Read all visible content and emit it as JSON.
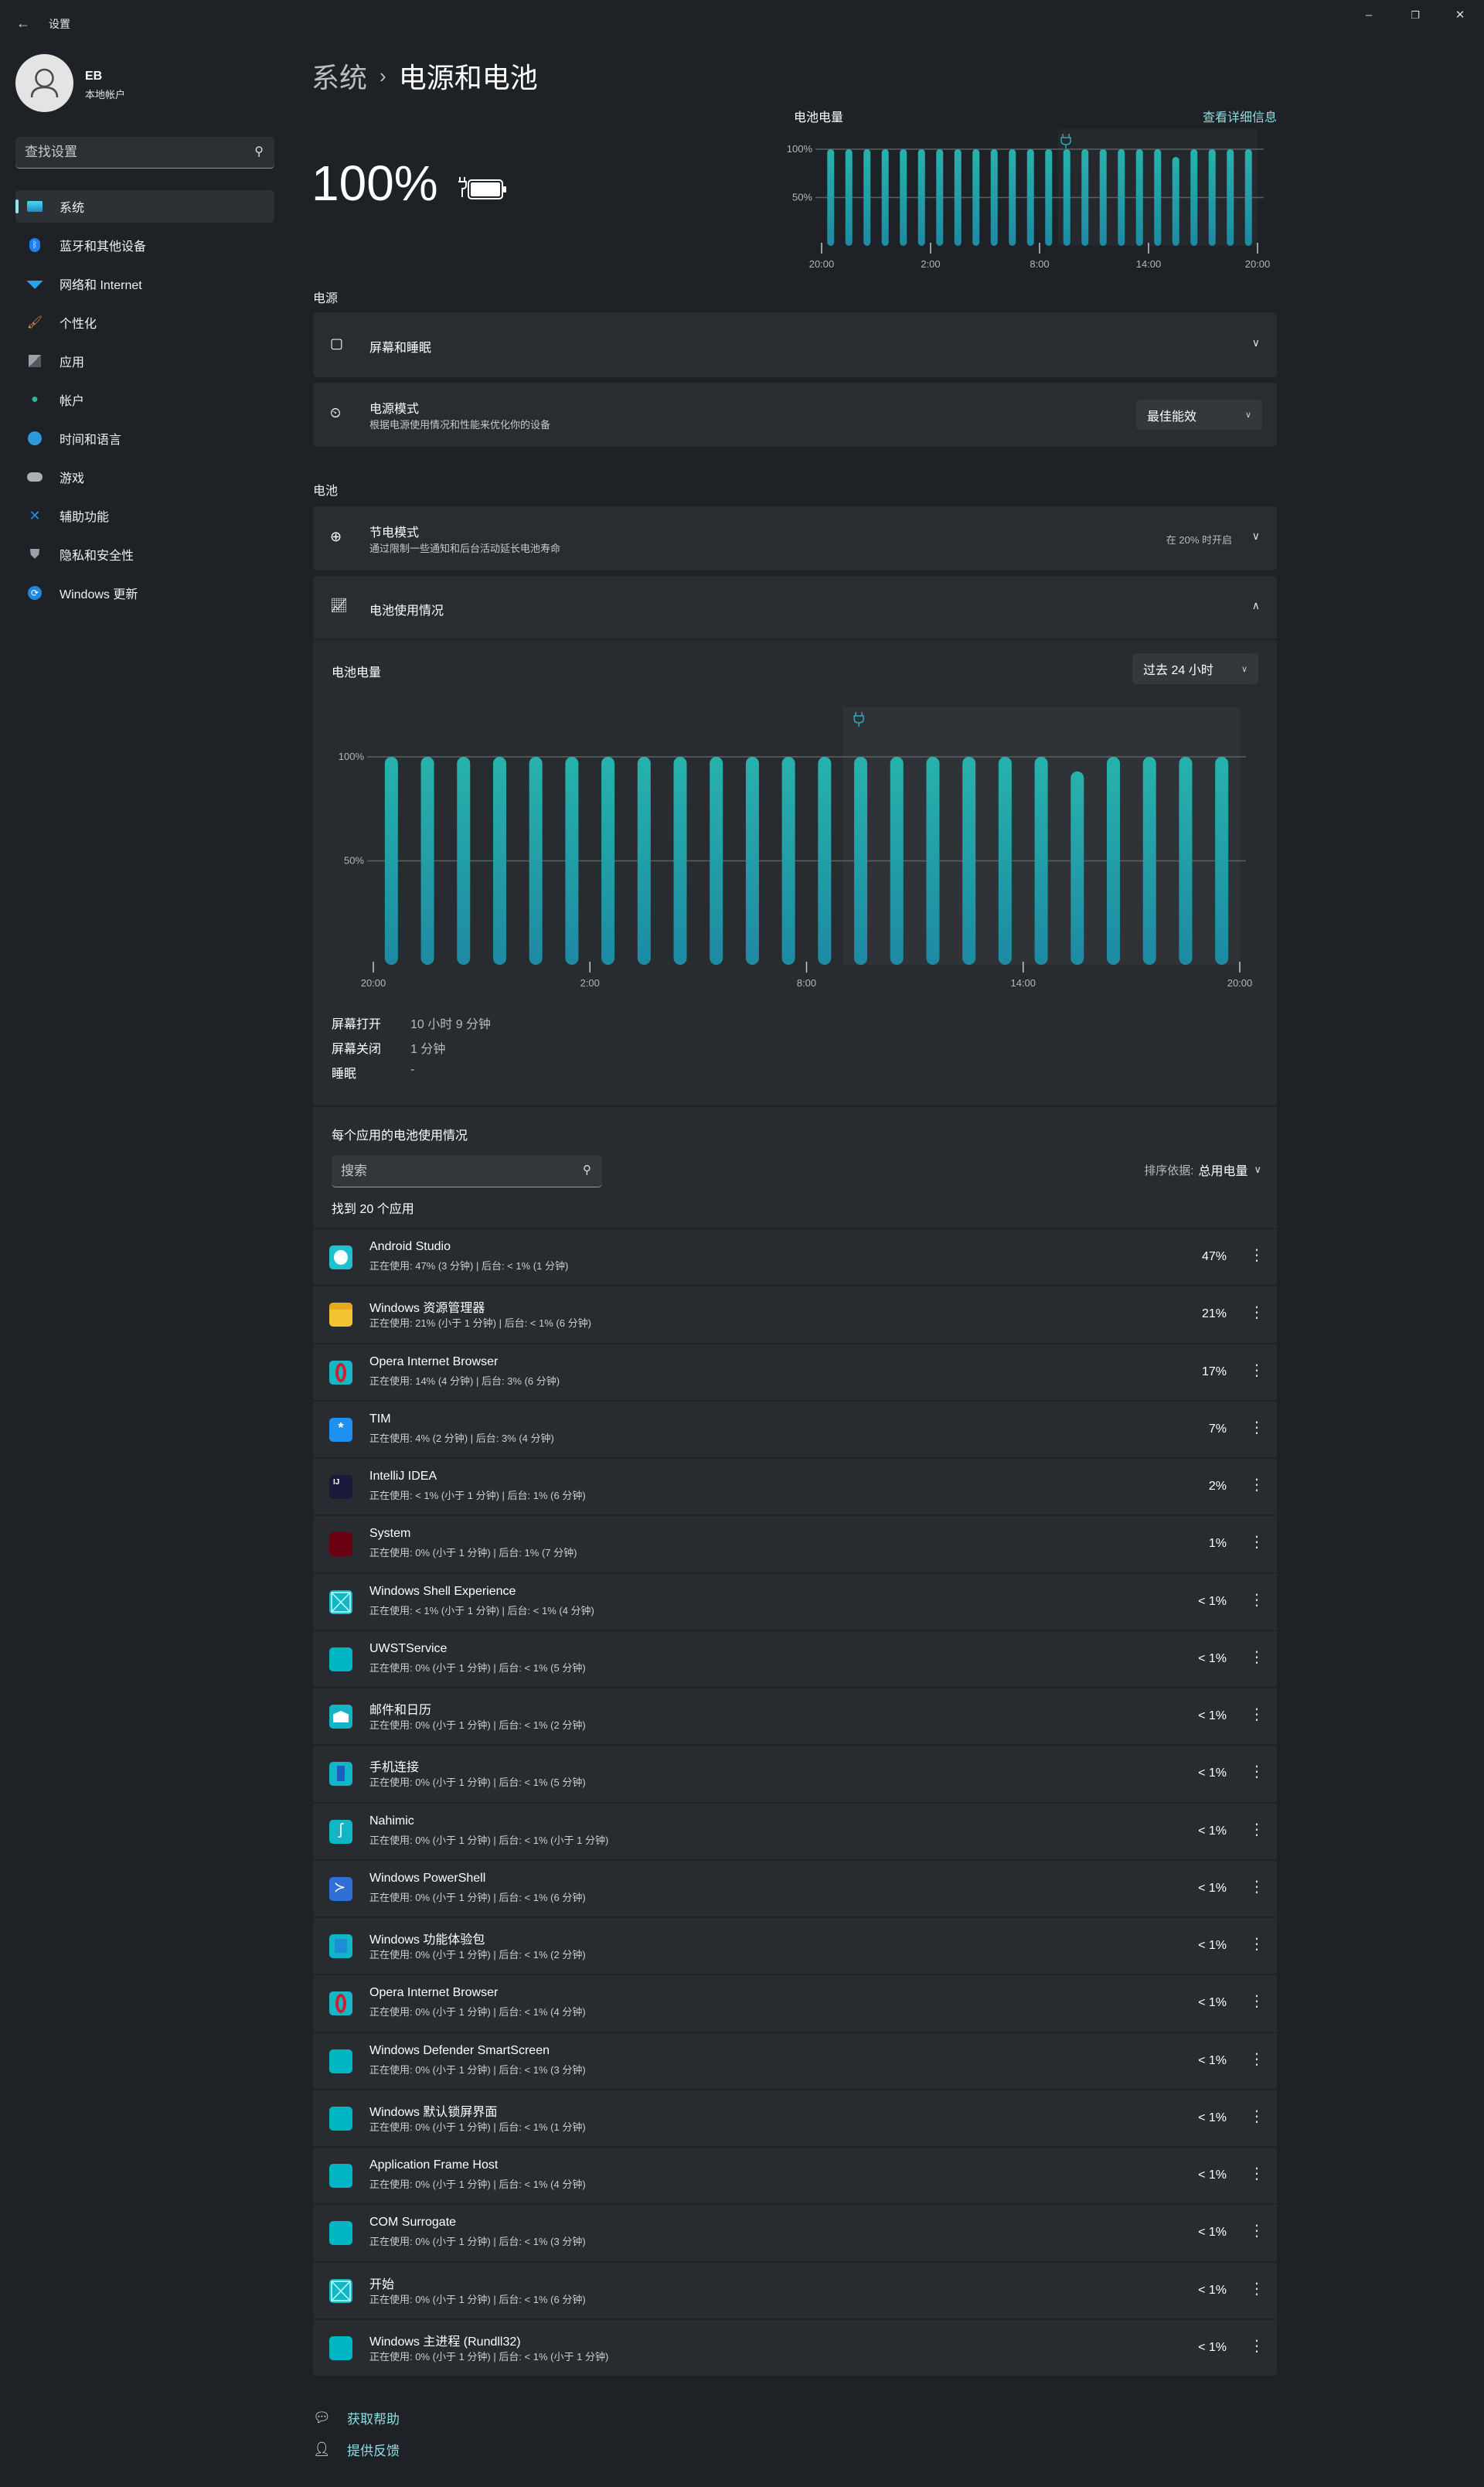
{
  "window": {
    "title": "设置",
    "controls": {
      "minimize": "–",
      "restore": "❐",
      "close": "✕"
    }
  },
  "user": {
    "name": "EB",
    "type": "本地帐户"
  },
  "sidebar": {
    "search_placeholder": "查找设置",
    "items": [
      {
        "label": "系统",
        "icon": "system-icon",
        "active": true
      },
      {
        "label": "蓝牙和其他设备",
        "icon": "bluetooth-icon"
      },
      {
        "label": "网络和 Internet",
        "icon": "wifi-icon"
      },
      {
        "label": "个性化",
        "icon": "brush-icon"
      },
      {
        "label": "应用",
        "icon": "apps-icon"
      },
      {
        "label": "帐户",
        "icon": "account-icon"
      },
      {
        "label": "时间和语言",
        "icon": "globe-clock-icon"
      },
      {
        "label": "游戏",
        "icon": "gamepad-icon"
      },
      {
        "label": "辅助功能",
        "icon": "accessibility-icon"
      },
      {
        "label": "隐私和安全性",
        "icon": "shield-icon"
      },
      {
        "label": "Windows 更新",
        "icon": "update-icon"
      }
    ]
  },
  "breadcrumb": {
    "parent": "系统",
    "separator": "›",
    "current": "电源和电池"
  },
  "battery": {
    "percent": "100%",
    "state_icon": "battery-charging-icon"
  },
  "mini_chart": {
    "title": "电池电量",
    "link": "查看详细信息"
  },
  "power_section": {
    "label": "电源",
    "screen_sleep": {
      "title": "屏幕和睡眠"
    },
    "power_mode": {
      "title": "电源模式",
      "subtitle": "根据电源使用情况和性能来优化你的设备",
      "value": "最佳能效"
    }
  },
  "battery_section": {
    "label": "电池",
    "saver": {
      "title": "节电模式",
      "subtitle": "通过限制一些通知和后台活动延长电池寿命",
      "status": "在 20% 时开启"
    },
    "usage": {
      "title": "电池使用情况",
      "chart_title": "电池电量",
      "range": "过去 24 小时",
      "stats": [
        {
          "label": "屏幕打开",
          "value": "10 小时 9 分钟"
        },
        {
          "label": "屏幕关闭",
          "value": "1 分钟"
        },
        {
          "label": "睡眠",
          "value": "-"
        }
      ],
      "per_app_title": "每个应用的电池使用情况",
      "search_placeholder": "搜索",
      "sort_label": "排序依据:",
      "sort_value": "总用电量",
      "found": "找到 20 个应用"
    }
  },
  "apps": [
    {
      "name": "Android Studio",
      "detail": "正在使用: 47% (3 分钟) | 后台: < 1% (1 分钟)",
      "pct": "47%",
      "icon": "android-studio-icon",
      "color": "#1fc1cf"
    },
    {
      "name": "Windows 资源管理器",
      "detail": "正在使用: 21% (小于 1 分钟) | 后台: < 1% (6 分钟)",
      "pct": "21%",
      "icon": "file-explorer-icon",
      "color": "#f3c434"
    },
    {
      "name": "Opera Internet Browser",
      "detail": "正在使用: 14% (4 分钟) | 后台: 3% (6 分钟)",
      "pct": "17%",
      "icon": "opera-icon",
      "color": "#13b7c6"
    },
    {
      "name": "TIM",
      "detail": "正在使用: 4% (2 分钟) | 后台: 3% (4 分钟)",
      "pct": "7%",
      "icon": "tim-icon",
      "color": "#1e90f0"
    },
    {
      "name": "IntelliJ IDEA",
      "detail": "正在使用: < 1% (小于 1 分钟) | 后台: 1% (6 分钟)",
      "pct": "2%",
      "icon": "intellij-icon",
      "color": "#1a1a3a"
    },
    {
      "name": "System",
      "detail": "正在使用: 0% (小于 1 分钟) | 后台: 1% (7 分钟)",
      "pct": "1%",
      "icon": "system-app-icon",
      "color": "#6b0010"
    },
    {
      "name": "Windows Shell Experience",
      "detail": "正在使用: < 1% (小于 1 分钟) | 后台: < 1% (4 分钟)",
      "pct": "< 1%",
      "icon": "placeholder-x-icon",
      "color": "#15b6c4"
    },
    {
      "name": "UWSTService",
      "detail": "正在使用: 0% (小于 1 分钟) | 后台: < 1% (5 分钟)",
      "pct": "< 1%",
      "icon": "generic-app-icon",
      "color": "#00b6c4"
    },
    {
      "name": "邮件和日历",
      "detail": "正在使用: 0% (小于 1 分钟) | 后台: < 1% (2 分钟)",
      "pct": "< 1%",
      "icon": "mail-icon",
      "color": "#12b5c5"
    },
    {
      "name": "手机连接",
      "detail": "正在使用: 0% (小于 1 分钟) | 后台: < 1% (5 分钟)",
      "pct": "< 1%",
      "icon": "phone-link-icon",
      "color": "#12b5c5"
    },
    {
      "name": "Nahimic",
      "detail": "正在使用: 0% (小于 1 分钟) | 后台: < 1% (小于 1 分钟)",
      "pct": "< 1%",
      "icon": "nahimic-icon",
      "color": "#12b5c5"
    },
    {
      "name": "Windows PowerShell",
      "detail": "正在使用: 0% (小于 1 分钟) | 后台: < 1% (6 分钟)",
      "pct": "< 1%",
      "icon": "powershell-icon",
      "color": "#2f6fd6"
    },
    {
      "name": "Windows 功能体验包",
      "detail": "正在使用: 0% (小于 1 分钟) | 后台: < 1% (2 分钟)",
      "pct": "< 1%",
      "icon": "feature-pack-icon",
      "color": "#12b5c5"
    },
    {
      "name": "Opera Internet Browser",
      "detail": "正在使用: 0% (小于 1 分钟) | 后台: < 1% (4 分钟)",
      "pct": "< 1%",
      "icon": "opera-icon",
      "color": "#13b7c6"
    },
    {
      "name": "Windows Defender SmartScreen",
      "detail": "正在使用: 0% (小于 1 分钟) | 后台: < 1% (3 分钟)",
      "pct": "< 1%",
      "icon": "generic-app-icon",
      "color": "#00b6c4"
    },
    {
      "name": "Windows 默认锁屏界面",
      "detail": "正在使用: 0% (小于 1 分钟) | 后台: < 1% (1 分钟)",
      "pct": "< 1%",
      "icon": "generic-app-icon",
      "color": "#00b6c4"
    },
    {
      "name": "Application Frame Host",
      "detail": "正在使用: 0% (小于 1 分钟) | 后台: < 1% (4 分钟)",
      "pct": "< 1%",
      "icon": "generic-app-icon",
      "color": "#00b6c4"
    },
    {
      "name": "COM Surrogate",
      "detail": "正在使用: 0% (小于 1 分钟) | 后台: < 1% (3 分钟)",
      "pct": "< 1%",
      "icon": "generic-app-icon",
      "color": "#00b6c4"
    },
    {
      "name": "开始",
      "detail": "正在使用: 0% (小于 1 分钟) | 后台: < 1% (6 分钟)",
      "pct": "< 1%",
      "icon": "placeholder-x-icon",
      "color": "#15b6c4"
    },
    {
      "name": "Windows 主进程 (Rundll32)",
      "detail": "正在使用: 0% (小于 1 分钟) | 后台: < 1% (小于 1 分钟)",
      "pct": "< 1%",
      "icon": "generic-app-icon",
      "color": "#00b6c4"
    }
  ],
  "footer": {
    "help": "获取帮助",
    "feedback": "提供反馈"
  },
  "colors": {
    "accent": "#8fdde6",
    "bar_top": "#27b2ac",
    "bar_bottom": "#1e8aa3"
  },
  "chart_data": [
    {
      "type": "bar",
      "title": "电池电量",
      "categories": [
        "20:00",
        "21:00",
        "22:00",
        "23:00",
        "0:00",
        "1:00",
        "2:00",
        "3:00",
        "4:00",
        "5:00",
        "6:00",
        "7:00",
        "8:00",
        "9:00",
        "10:00",
        "11:00",
        "12:00",
        "13:00",
        "14:00",
        "15:00",
        "16:00",
        "17:00",
        "18:00",
        "19:00"
      ],
      "values": [
        100,
        100,
        100,
        100,
        100,
        100,
        100,
        100,
        100,
        100,
        100,
        100,
        100,
        100,
        100,
        100,
        100,
        100,
        100,
        92,
        100,
        100,
        100,
        100
      ],
      "xticks": [
        "20:00",
        "2:00",
        "8:00",
        "14:00",
        "20:00"
      ],
      "yticks": [
        "100%",
        "50%"
      ],
      "ylim": [
        0,
        100
      ],
      "charging_from_index": 13,
      "annotation": "plug-icon",
      "grid": true
    },
    {
      "type": "bar",
      "title": "电池电量",
      "categories": [
        "20:00",
        "21:00",
        "22:00",
        "23:00",
        "0:00",
        "1:00",
        "2:00",
        "3:00",
        "4:00",
        "5:00",
        "6:00",
        "7:00",
        "8:00",
        "9:00",
        "10:00",
        "11:00",
        "12:00",
        "13:00",
        "14:00",
        "15:00",
        "16:00",
        "17:00",
        "18:00",
        "19:00"
      ],
      "values": [
        100,
        100,
        100,
        100,
        100,
        100,
        100,
        100,
        100,
        100,
        100,
        100,
        100,
        100,
        100,
        100,
        100,
        100,
        100,
        93,
        100,
        100,
        100,
        100
      ],
      "xticks": [
        "20:00",
        "2:00",
        "8:00",
        "14:00",
        "20:00"
      ],
      "yticks": [
        "100%",
        "50%"
      ],
      "ylim": [
        0,
        100
      ],
      "charging_from_index": 13,
      "annotation": "plug-icon",
      "grid": true
    }
  ]
}
